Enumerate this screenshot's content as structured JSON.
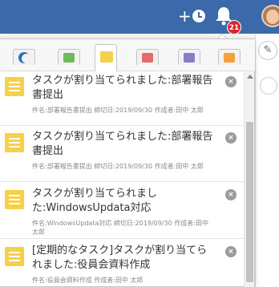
{
  "header": {
    "add_label": "+",
    "notification_count": "21",
    "colors": {
      "bar": "#3b69a9",
      "badge": "#d6262b"
    }
  },
  "notifications": {
    "items": [
      {
        "title": "タスクが割り当てられました:部署報告書提出",
        "meta": "件名:部署報告書提出 締切日:2019/09/30 作成者:田中 太郎"
      },
      {
        "title": "タスクが割り当てられました:部署報告書提出",
        "meta": "件名:部署報告書提出 締切日:2019/09/30 作成者:田中 太郎"
      },
      {
        "title": "タスクが割り当てられました:WindowsUpdata対応",
        "meta": "件名:WindowsUpdata対応 締切日:2019/09/30 作成者:田中 太郎"
      },
      {
        "title": "[定期的なタスク]タスクが割り当てられました:役員会資料作成",
        "meta": "件名:役員会資料作成 作成者:田中 太郎"
      }
    ],
    "close_glyph": "×"
  },
  "tabs": [
    {
      "icon": "moon-icon",
      "color": "#2b6fb5"
    },
    {
      "icon": "calendar-green-icon",
      "color": "#6fba5b"
    },
    {
      "icon": "task-list-icon",
      "color": "#f6cf4b"
    },
    {
      "icon": "calendar-red-icon",
      "color": "#e86a6a"
    },
    {
      "icon": "calendar-purple-icon",
      "color": "#8a7cc9"
    },
    {
      "icon": "note-orange-icon",
      "color": "#f3a23a"
    }
  ]
}
